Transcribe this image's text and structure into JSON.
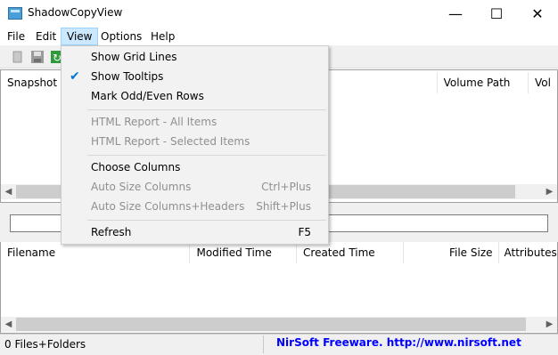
{
  "window": {
    "title": "ShadowCopyView",
    "minimize": "—",
    "maximize": "☐",
    "close": "✕"
  },
  "menubar": {
    "file": "File",
    "edit": "Edit",
    "view": "View",
    "options": "Options",
    "help": "Help"
  },
  "upper_list": {
    "columns": [
      "Snapshot N",
      "Volume Path",
      "Vol"
    ]
  },
  "lower_list": {
    "columns": [
      "Filename",
      "Modified Time",
      "Created Time",
      "File Size",
      "Attributes"
    ]
  },
  "filter": {
    "value": ""
  },
  "statusbar": {
    "count": "0 Files+Folders",
    "link": "NirSoft Freeware.  http://www.nirsoft.net"
  },
  "view_menu": {
    "show_grid_lines": "Show Grid Lines",
    "show_tooltips": "Show Tooltips",
    "show_tooltips_checked": "✔",
    "mark_odd_even": "Mark Odd/Even Rows",
    "html_all": "HTML Report - All Items",
    "html_selected": "HTML Report - Selected Items",
    "choose_columns": "Choose Columns",
    "auto_size": "Auto Size Columns",
    "auto_size_sc": "Ctrl+Plus",
    "auto_size_headers": "Auto Size Columns+Headers",
    "auto_size_headers_sc": "Shift+Plus",
    "refresh": "Refresh",
    "refresh_sc": "F5"
  },
  "colors": {
    "menu_highlight": "#cce8ff",
    "link": "#0000ff",
    "disabled_text": "#8f8f8f",
    "check": "#0078d7"
  }
}
